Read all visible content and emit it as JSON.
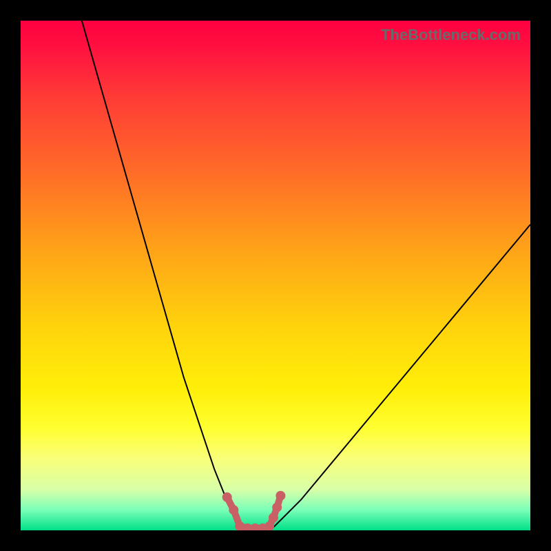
{
  "watermark": "TheBottleneck.com",
  "chart_data": {
    "type": "line",
    "title": "",
    "xlabel": "",
    "ylabel": "",
    "xlim": [
      0,
      100
    ],
    "ylim": [
      0,
      100
    ],
    "grid": false,
    "series": [
      {
        "name": "bottleneck-curve",
        "color": "#000000",
        "x": [
          12,
          14,
          16,
          18,
          20,
          22,
          24,
          26,
          28,
          30,
          32,
          34,
          36,
          38,
          40,
          42,
          43,
          44,
          45,
          46,
          47,
          48,
          49,
          50,
          52,
          55,
          60,
          65,
          70,
          75,
          80,
          85,
          90,
          95,
          100
        ],
        "y": [
          100,
          93,
          86,
          79,
          72,
          65,
          58,
          51,
          44,
          37,
          30,
          24,
          18,
          12,
          7,
          3,
          1,
          0,
          0,
          0,
          0,
          0,
          0,
          1,
          3,
          6,
          12,
          18,
          24,
          30,
          36,
          42,
          48,
          54,
          60
        ]
      },
      {
        "name": "optimal-markers",
        "color": "#c86065",
        "marker": "circle",
        "x": [
          40.5,
          41.8,
          43.0,
          44.5,
          46.0,
          47.5,
          48.8,
          49.6,
          50.3,
          51.0
        ],
        "y": [
          6.5,
          4.0,
          0.8,
          0.4,
          0.4,
          0.4,
          0.8,
          2.5,
          4.5,
          6.8
        ]
      }
    ],
    "gradient_bands": [
      {
        "pos": 0.0,
        "color": "#ff0040"
      },
      {
        "pos": 0.3,
        "color": "#ff6d27"
      },
      {
        "pos": 0.6,
        "color": "#ffd30c"
      },
      {
        "pos": 0.8,
        "color": "#ffff30"
      },
      {
        "pos": 0.96,
        "color": "#7affb8"
      },
      {
        "pos": 1.0,
        "color": "#00e088"
      }
    ]
  }
}
